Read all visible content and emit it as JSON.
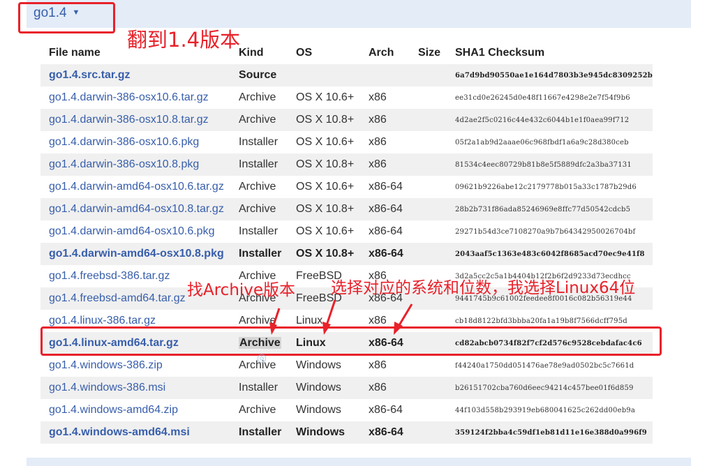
{
  "version_selector": {
    "label": "go1.4",
    "caret": "▼"
  },
  "annotations": {
    "version": "翻到1.4版本",
    "archive": "找Archive版本",
    "system": "选择对应的系统和位数，我选择Linux64位"
  },
  "table": {
    "headers": [
      "File name",
      "Kind",
      "OS",
      "Arch",
      "Size",
      "SHA1 Checksum"
    ],
    "rows": [
      {
        "file": "go1.4.src.tar.gz",
        "kind": "Source",
        "os": "",
        "arch": "",
        "size": "",
        "sha": "6a7d9bd90550ae1e164d7803b3e945dc8309252b",
        "bold": true
      },
      {
        "file": "go1.4.darwin-386-osx10.6.tar.gz",
        "kind": "Archive",
        "os": "OS X 10.6+",
        "arch": "x86",
        "size": "",
        "sha": "ee31cd0e26245d0e48f11667e4298e2e7f54f9b6",
        "bold": false
      },
      {
        "file": "go1.4.darwin-386-osx10.8.tar.gz",
        "kind": "Archive",
        "os": "OS X 10.8+",
        "arch": "x86",
        "size": "",
        "sha": "4d2ae2f5c0216c44e432c6044b1e1f0aea99f712",
        "bold": false
      },
      {
        "file": "go1.4.darwin-386-osx10.6.pkg",
        "kind": "Installer",
        "os": "OS X 10.6+",
        "arch": "x86",
        "size": "",
        "sha": "05f2a1ab9d2aaae06c968fbdf1a6a9c28d380ceb",
        "bold": false
      },
      {
        "file": "go1.4.darwin-386-osx10.8.pkg",
        "kind": "Installer",
        "os": "OS X 10.8+",
        "arch": "x86",
        "size": "",
        "sha": "81534c4eec80729b81b8e5f5889dfc2a3ba37131",
        "bold": false
      },
      {
        "file": "go1.4.darwin-amd64-osx10.6.tar.gz",
        "kind": "Archive",
        "os": "OS X 10.6+",
        "arch": "x86-64",
        "size": "",
        "sha": "09621b9226abe12c2179778b015a33c1787b29d6",
        "bold": false
      },
      {
        "file": "go1.4.darwin-amd64-osx10.8.tar.gz",
        "kind": "Archive",
        "os": "OS X 10.8+",
        "arch": "x86-64",
        "size": "",
        "sha": "28b2b731f86ada85246969e8ffc77d50542cdcb5",
        "bold": false
      },
      {
        "file": "go1.4.darwin-amd64-osx10.6.pkg",
        "kind": "Installer",
        "os": "OS X 10.6+",
        "arch": "x86-64",
        "size": "",
        "sha": "29271b54d3ce7108270a9b7b64342950026704bf",
        "bold": false
      },
      {
        "file": "go1.4.darwin-amd64-osx10.8.pkg",
        "kind": "Installer",
        "os": "OS X 10.8+",
        "arch": "x86-64",
        "size": "",
        "sha": "2043aaf5c1363e483c6042f8685acd70ec9e41f8",
        "bold": true
      },
      {
        "file": "go1.4.freebsd-386.tar.gz",
        "kind": "Archive",
        "os": "FreeBSD",
        "arch": "x86",
        "size": "",
        "sha": "3d2a5cc2c5a1b4404b12f2b6f2d9233d73ecdhcc",
        "bold": false
      },
      {
        "file": "go1.4.freebsd-amd64.tar.gz",
        "kind": "Archive",
        "os": "FreeBSD",
        "arch": "x86-64",
        "size": "",
        "sha": "9441745b9c61002feedee8f0016c082b56319e44",
        "bold": false
      },
      {
        "file": "go1.4.linux-386.tar.gz",
        "kind": "Archive",
        "os": "Linux",
        "arch": "x86",
        "size": "",
        "sha": "cb18d8122bfd3bbba20fa1a19b8f7566dcff795d",
        "bold": false
      },
      {
        "file": "go1.4.linux-amd64.tar.gz",
        "kind": "Archive",
        "os": "Linux",
        "arch": "x86-64",
        "size": "",
        "sha": "cd82abcb0734f82f7cf2d576c9528cebdafac4c6",
        "bold": true,
        "selected": true
      },
      {
        "file": "go1.4.windows-386.zip",
        "kind": "Archive",
        "os": "Windows",
        "arch": "x86",
        "size": "",
        "sha": "f44240a1750dd051476ae78e9ad0502bc5c7661d",
        "bold": false
      },
      {
        "file": "go1.4.windows-386.msi",
        "kind": "Installer",
        "os": "Windows",
        "arch": "x86",
        "size": "",
        "sha": "b26151702cba760d6eec94214c457bee01f6d859",
        "bold": false
      },
      {
        "file": "go1.4.windows-amd64.zip",
        "kind": "Archive",
        "os": "Windows",
        "arch": "x86-64",
        "size": "",
        "sha": "44f103d558b293919eb680041625c262dd00eb9a",
        "bold": false
      },
      {
        "file": "go1.4.windows-amd64.msi",
        "kind": "Installer",
        "os": "Windows",
        "arch": "x86-64",
        "size": "",
        "sha": "359124f2bba4c59df1eb81d11e16e388d0a996f9",
        "bold": true
      }
    ]
  },
  "colors": {
    "link": "#375eab",
    "annotation": "#e8212a",
    "band": "#e3ecf7",
    "row_stripe": "#f0f0f0"
  }
}
